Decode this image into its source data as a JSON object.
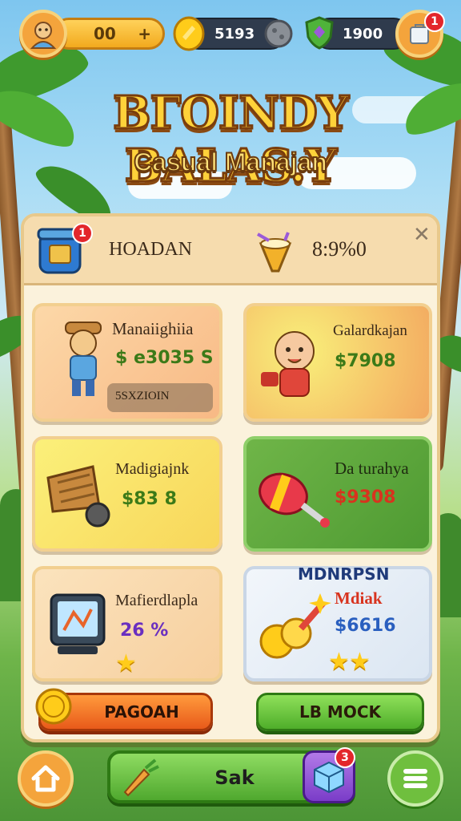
{
  "top_bar": {
    "level_value": "00",
    "level_plus": "+",
    "gold_value": "5193",
    "gem_value": "1900",
    "notification_count": "1"
  },
  "title": {
    "main": "BГOINDY BALAS.Y",
    "subtitle": "Casual Manajan"
  },
  "panel": {
    "header_label": "HOADAN",
    "header_badge": "1",
    "header_value": "8:9%0",
    "close_symbol": "✕"
  },
  "cards": [
    {
      "name": "Manaiighiia",
      "price": "$ e3035 S",
      "sub": "5SXZIOIN",
      "price_color": "#3c7a18"
    },
    {
      "name": "Galardkajan",
      "price": "$7908",
      "price_color": "#3c7a18"
    },
    {
      "name": "Madigiajnk",
      "price": "$83 8",
      "price_color": "#3c7a18"
    },
    {
      "name": "Da turahya",
      "price": "$9308",
      "price_color": "#d8331e"
    },
    {
      "name": "Mafierdlapla",
      "price": "26 %",
      "price_color": "#6a2fc0",
      "stars": 1
    },
    {
      "name": "Mdiak",
      "price": "$6616",
      "top_label": "MDNRPSN",
      "price_color": "#2a5fbf",
      "stars": 2
    }
  ],
  "buttons": {
    "left_label": "PAGOAH",
    "right_label": "LB MOCK"
  },
  "bottom_nav": {
    "center_label": "Sak",
    "badge_count": "3"
  },
  "colors": {
    "accent_orange": "#f4a43c",
    "accent_green": "#5fb83a",
    "panel_bg": "#fbf2dc"
  }
}
